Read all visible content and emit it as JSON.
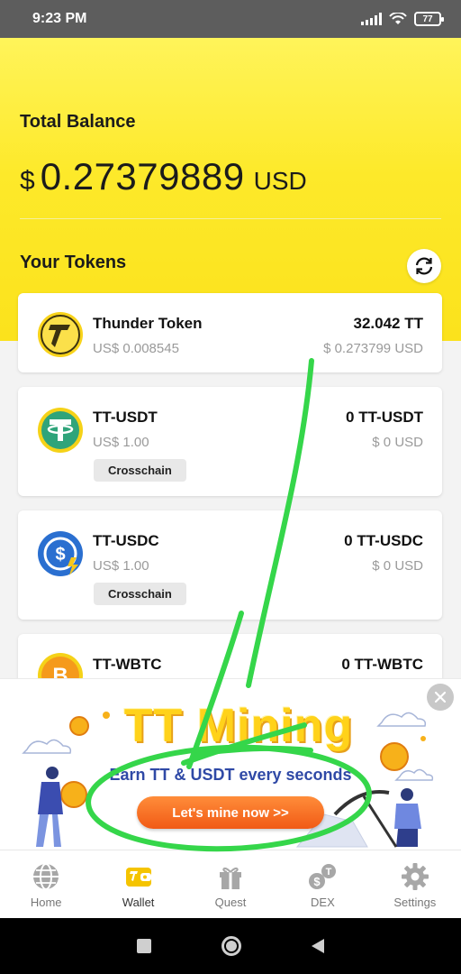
{
  "status_bar": {
    "time": "9:23 PM",
    "battery": "77"
  },
  "balance": {
    "label": "Total Balance",
    "currency_symbol": "$",
    "value": "0.27379889",
    "unit": "USD"
  },
  "tokens_section": {
    "label": "Your Tokens"
  },
  "tokens": [
    {
      "name": "Thunder Token",
      "price": "US$ 0.008545",
      "amount": "32.042 TT",
      "value": "$ 0.273799 USD",
      "icon": "thunder-token-icon"
    },
    {
      "name": "TT-USDT",
      "price": "US$ 1.00",
      "amount": "0 TT-USDT",
      "value": "$ 0 USD",
      "badge": "Crosschain",
      "icon": "usdt-icon"
    },
    {
      "name": "TT-USDC",
      "price": "US$ 1.00",
      "amount": "0 TT-USDC",
      "value": "$ 0 USD",
      "badge": "Crosschain",
      "icon": "usdc-icon"
    },
    {
      "name": "TT-WBTC",
      "amount": "0 TT-WBTC",
      "icon": "bitcoin-icon"
    }
  ],
  "ad": {
    "title": "TT Mining",
    "subtitle": "Earn TT & USDT every seconds",
    "button": "Let's mine now >>"
  },
  "tabs": [
    {
      "label": "Home",
      "icon": "globe-icon"
    },
    {
      "label": "Wallet",
      "icon": "wallet-icon",
      "active": true
    },
    {
      "label": "Quest",
      "icon": "gift-icon"
    },
    {
      "label": "DEX",
      "icon": "dex-icon"
    },
    {
      "label": "Settings",
      "icon": "gear-icon"
    }
  ],
  "colors": {
    "header_yellow": "#fde92a",
    "ad_button": "#f15a16",
    "annotation_green": "#35d64a",
    "tab_active": "#f5c400"
  }
}
